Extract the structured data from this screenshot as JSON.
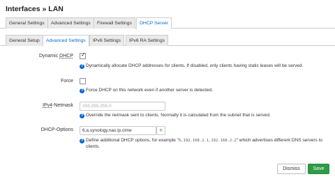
{
  "title": "Interfaces » LAN",
  "main_tabs": [
    {
      "label": "General Settings",
      "active": false
    },
    {
      "label": "Advanced Settings",
      "active": false
    },
    {
      "label": "Firewall Settings",
      "active": false
    },
    {
      "label": "DHCP Server",
      "active": true
    }
  ],
  "sub_tabs": [
    {
      "label": "General Setup",
      "active": false
    },
    {
      "label": "Advanced Settings",
      "active": true
    },
    {
      "label": "IPv6 Settings",
      "active": false
    },
    {
      "label": "IPv6 RA Settings",
      "active": false
    }
  ],
  "dynamic_dhcp": {
    "label_prefix": "Dynamic ",
    "label_abbr": "DHCP",
    "checked": true,
    "check_glyph": "✓",
    "help": "Dynamically allocate DHCP addresses for clients. If disabled, only clients having static leases will be served."
  },
  "force": {
    "label": "Force",
    "checked": false,
    "help": "Force DHCP on this network even if another server is detected."
  },
  "netmask": {
    "label_abbr": "IPv4",
    "label_suffix": "-Netmask",
    "placeholder": "255.255.255.0",
    "value": "",
    "help": "Override the netmask sent to clients. Normally it is calculated from the subnet that is served."
  },
  "dhcp_options": {
    "label": "DHCP-Options",
    "value": "6,a.synology.nas.ip.cime",
    "add_glyph": "+",
    "help_prefix": "Define additional DHCP options, for example \"",
    "help_example": "6,192.168.2.1,192.168.2.2",
    "help_suffix": "\" which advertises different DNS servers to clients."
  },
  "help_glyph": "?",
  "footer": {
    "dismiss_label": "Dismiss",
    "save_label": "Save"
  },
  "colors": {
    "accent": "#0069d6",
    "save": "#2e9b45"
  }
}
